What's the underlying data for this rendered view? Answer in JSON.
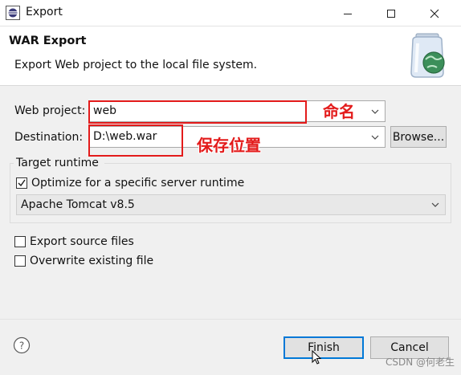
{
  "window": {
    "title": "Export"
  },
  "header": {
    "title": "WAR Export",
    "description": "Export Web project to the local file system."
  },
  "form": {
    "web_project_label": "Web project:",
    "web_project_value": "web",
    "destination_label": "Destination:",
    "destination_value": "D:\\web.war",
    "browse_label": "Browse..."
  },
  "target_runtime": {
    "group_label": "Target runtime",
    "optimize_label": "Optimize for a specific server runtime",
    "optimize_checked": true,
    "runtime_value": "Apache Tomcat v8.5"
  },
  "options": {
    "export_source_label": "Export source files",
    "export_source_checked": false,
    "overwrite_label": "Overwrite existing file",
    "overwrite_checked": false
  },
  "annotations": {
    "name_note": "命名",
    "location_note": "保存位置"
  },
  "footer": {
    "finish_label": "Finish",
    "cancel_label": "Cancel",
    "watermark": "CSDN @何老生"
  },
  "colors": {
    "annotation": "#e31b1b",
    "default_button_border": "#0078d7"
  }
}
